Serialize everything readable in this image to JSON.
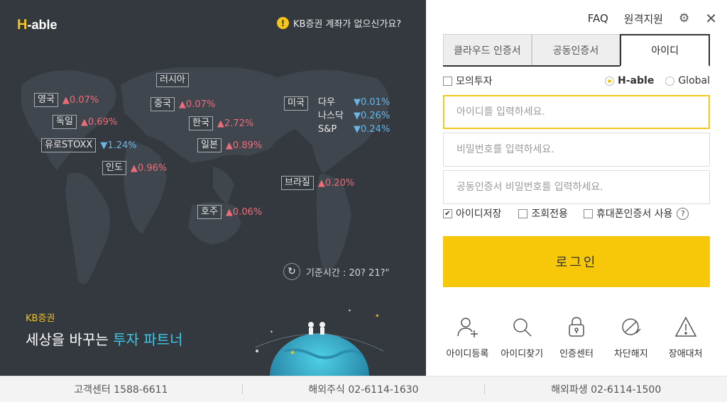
{
  "brand": {
    "logo_h": "H",
    "logo_rest": "-able",
    "no_account_text": "KB증권 계좌가 없으신가요?",
    "company_small": "KB증권",
    "slogan_pre": "세상을 바꾸는",
    "slogan_highlight": "투자 파트너"
  },
  "markets": [
    {
      "name": "영국",
      "direction": "up",
      "change": "0.07%"
    },
    {
      "name": "독일",
      "direction": "up",
      "change": "0.69%"
    },
    {
      "name": "유로STOXX",
      "direction": "down",
      "change": "1.24%"
    },
    {
      "name": "러시아",
      "direction": "none",
      "change": ""
    },
    {
      "name": "중국",
      "direction": "up",
      "change": "0.07%"
    },
    {
      "name": "인도",
      "direction": "up",
      "change": "0.96%"
    },
    {
      "name": "한국",
      "direction": "up",
      "change": "2.72%"
    },
    {
      "name": "일본",
      "direction": "up",
      "change": "0.89%"
    },
    {
      "name": "브라질",
      "direction": "up",
      "change": "0.20%"
    },
    {
      "name": "호주",
      "direction": "up",
      "change": "0.06%"
    },
    {
      "name": "미국",
      "direction": "none",
      "change": ""
    }
  ],
  "us_indices": [
    {
      "name": "다우",
      "direction": "down",
      "change": "0.01%"
    },
    {
      "name": "나스닥",
      "direction": "down",
      "change": "0.26%"
    },
    {
      "name": "S&P",
      "direction": "down",
      "change": "0.24%"
    }
  ],
  "reference_time": "기준시간 : 20? 21?\"",
  "topbar": {
    "faq": "FAQ",
    "remote": "원격지원"
  },
  "tabs": [
    {
      "label": "클라우드 인증서",
      "active": false
    },
    {
      "label": "공동인증서",
      "active": false
    },
    {
      "label": "아이디",
      "active": true
    }
  ],
  "options": {
    "mock_invest": "모의투자",
    "mock_invest_checked": false,
    "radio_hable": "H-able",
    "radio_global": "Global",
    "selected_radio": "H-able"
  },
  "fields": {
    "id_placeholder": "아이디를 입력하세요.",
    "id_value": "",
    "pw_placeholder": "비밀번호를 입력하세요.",
    "pw_value": "",
    "cert_pw_placeholder": "공동인증서 비밀번호를 입력하세요.",
    "cert_pw_value": ""
  },
  "options2": {
    "save_id": "아이디저장",
    "save_id_checked": true,
    "view_only": "조회전용",
    "view_only_checked": false,
    "mobile_cert": "휴대폰인증서 사용",
    "mobile_cert_checked": false,
    "help": "?"
  },
  "login_button": "로그인",
  "quick_links": [
    {
      "label": "아이디등록",
      "icon": "user-add-icon"
    },
    {
      "label": "아이디찾기",
      "icon": "search-icon"
    },
    {
      "label": "인증센터",
      "icon": "lock-icon"
    },
    {
      "label": "차단해지",
      "icon": "block-icon"
    },
    {
      "label": "장애대처",
      "icon": "warning-icon"
    }
  ],
  "footer": [
    "고객센터 1588-6611",
    "해외주식 02-6114-1630",
    "해외파생 02-6114-1500"
  ],
  "colors": {
    "left_bg": "#33393f",
    "accent": "#f7c80a",
    "up": "#ec6d7a",
    "down": "#68b7e9",
    "slogan_highlight": "#40c8e8"
  }
}
